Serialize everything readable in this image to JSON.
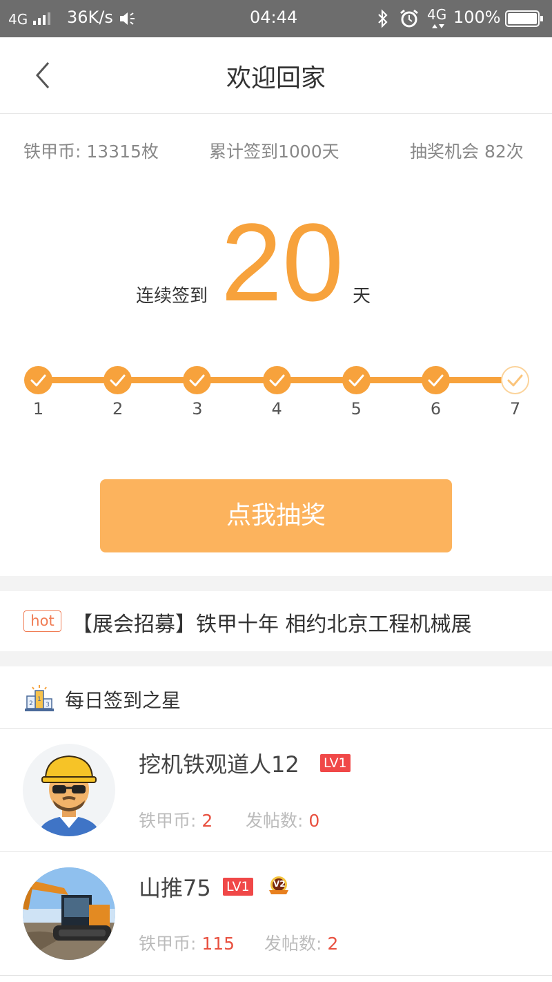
{
  "status_bar": {
    "network": "4G",
    "speed": "36K/s",
    "time": "04:44",
    "network2": "4G",
    "battery": "100%"
  },
  "nav": {
    "title": "欢迎回家"
  },
  "stats": {
    "coins": "铁甲币: 13315枚",
    "total_checkin": "累计签到1000天",
    "lottery_chances": "抽奖机会 82次"
  },
  "streak": {
    "label": "连续签到",
    "days": "20",
    "unit": "天"
  },
  "timeline": {
    "days": [
      "1",
      "2",
      "3",
      "4",
      "5",
      "6",
      "7"
    ],
    "completed": 6,
    "accent": "#f7a23c"
  },
  "lottery_button": {
    "label": "点我抽奖"
  },
  "hot": {
    "badge": "hot",
    "text": "【展会招募】铁甲十年 相约北京工程机械展"
  },
  "stars": {
    "title": "每日签到之星",
    "users": [
      {
        "name": "挖机铁观道人12",
        "level": "LV1",
        "coins_label": "铁甲币: ",
        "coins": "2",
        "posts_label": "发帖数: ",
        "posts": "0",
        "avatar": "worker-avatar"
      },
      {
        "name": "山推75",
        "level": "LV1",
        "v_badge": "V2",
        "coins_label": "铁甲币: ",
        "coins": "115",
        "posts_label": "发帖数: ",
        "posts": "2",
        "avatar": "excavator-photo"
      }
    ]
  }
}
